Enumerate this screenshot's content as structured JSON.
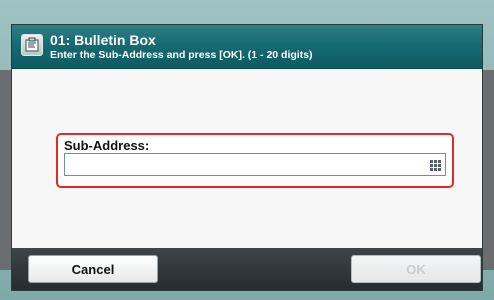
{
  "dialog": {
    "title": "01: Bulletin Box",
    "instruction": "Enter the Sub-Address and press [OK]. (1 - 20 digits)",
    "header_icon": "bulletin-box-icon"
  },
  "field": {
    "label": "Sub-Address:",
    "value": "",
    "placeholder": "",
    "keypad_icon": "keypad-icon",
    "highlight_color": "#e02a2a"
  },
  "footer": {
    "cancel_label": "Cancel",
    "ok_label": "OK"
  },
  "colors": {
    "header": "#166b72",
    "frame": "#9fc2c2"
  }
}
